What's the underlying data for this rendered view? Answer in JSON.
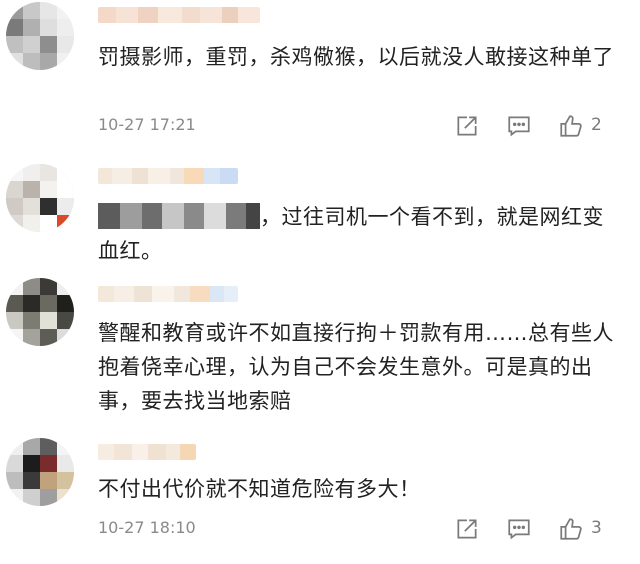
{
  "comments": [
    {
      "text": "罚摄影师，重罚，杀鸡儆猴，以后就没人敢接这种单了",
      "time": "10-27 17:21",
      "likes": "2"
    },
    {
      "text": "，过往司机一个看不到，就是网红变血红。"
    },
    {
      "text": "警醒和教育或许不如直接行拘＋罚款有用……总有些人抱着侥幸心理，认为自己不会发生意外。可是真的出事，要去找当地索赔"
    },
    {
      "text": "不付出代价就不知道危险有多大！",
      "time": "10-27 18:10",
      "likes": "3"
    }
  ],
  "icons": {
    "share": "share-icon",
    "comment": "comment-icon",
    "like": "like-icon"
  },
  "colors": {
    "text": "#222222",
    "meta": "#8a8a8a",
    "icon": "#7a7a7a"
  }
}
